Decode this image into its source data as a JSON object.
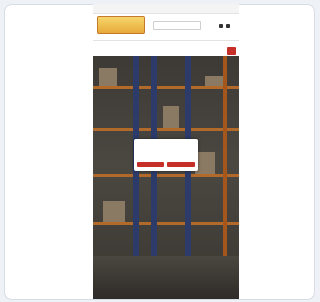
{
  "colors": {
    "accent": "#c62f28",
    "background": "#eef1f5"
  },
  "topbar": {
    "left_items": [
      "",
      ""
    ],
    "right_text": ""
  },
  "header": {
    "logo_text": "",
    "search_placeholder": "",
    "icons": [
      "user-icon",
      "cart-icon"
    ]
  },
  "nav": {
    "row1": [
      "",
      "",
      "",
      "",
      ""
    ],
    "row2": [
      "",
      "",
      "",
      ""
    ],
    "menu_button_icon": "menu-icon"
  },
  "modal": {
    "lines": [
      "",
      "",
      "",
      ""
    ],
    "buttons": [
      "",
      ""
    ]
  },
  "hero": {
    "title": "",
    "subtitle": ""
  }
}
